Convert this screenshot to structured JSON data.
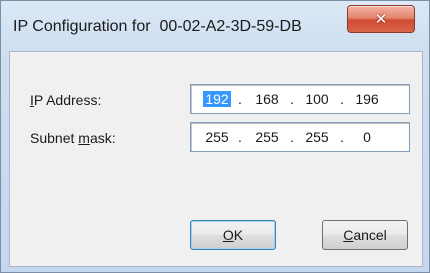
{
  "window": {
    "title": "IP Configuration for  00-02-A2-3D-59-DB",
    "close_glyph": "✕",
    "close_icon": "close-icon"
  },
  "form": {
    "ip_label_accel": "I",
    "ip_label_rest": "P Address:",
    "mask_label_pre": "Subnet ",
    "mask_label_accel": "m",
    "mask_label_rest": "ask:",
    "ip_address": {
      "o1": "192",
      "o2": "168",
      "o3": "100",
      "o4": "196"
    },
    "subnet_mask": {
      "o1": "255",
      "o2": "255",
      "o3": "255",
      "o4": "0"
    },
    "separator": "."
  },
  "buttons": {
    "ok_accel": "O",
    "ok_rest": "K",
    "cancel_accel": "C",
    "cancel_rest": "ancel"
  },
  "colors": {
    "selection": "#3399ff",
    "close_button": "#cf4b31"
  }
}
